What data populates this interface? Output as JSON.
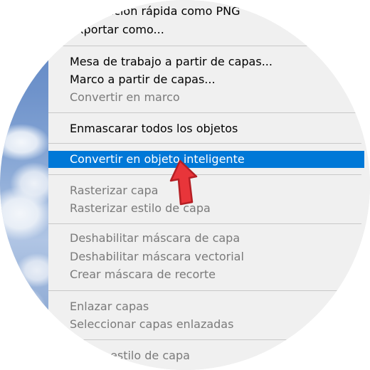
{
  "menu": {
    "items": [
      {
        "label": "Exportación rápida como PNG",
        "enabled": true
      },
      {
        "label": "Exportar como...",
        "enabled": true
      },
      {
        "label": "Mesa de trabajo a partir de capas...",
        "enabled": true
      },
      {
        "label": "Marco a partir de capas...",
        "enabled": true
      },
      {
        "label": "Convertir en marco",
        "enabled": false
      },
      {
        "label": "Enmascarar todos los objetos",
        "enabled": true
      },
      {
        "label": "Convertir en objeto inteligente",
        "enabled": true,
        "highlighted": true
      },
      {
        "label": "Rasterizar capa",
        "enabled": false
      },
      {
        "label": "Rasterizar estilo de capa",
        "enabled": false
      },
      {
        "label": "Deshabilitar máscara de capa",
        "enabled": false
      },
      {
        "label": "Deshabilitar máscara vectorial",
        "enabled": false
      },
      {
        "label": "Crear máscara de recorte",
        "enabled": false
      },
      {
        "label": "Enlazar capas",
        "enabled": false
      },
      {
        "label": "Seleccionar capas enlazadas",
        "enabled": false
      },
      {
        "label": "Copiar estilo de capa",
        "enabled": false
      }
    ]
  },
  "colors": {
    "highlight": "#0078d7",
    "arrow": "#e8353a"
  },
  "pointer_icon": "red-arrow-icon"
}
